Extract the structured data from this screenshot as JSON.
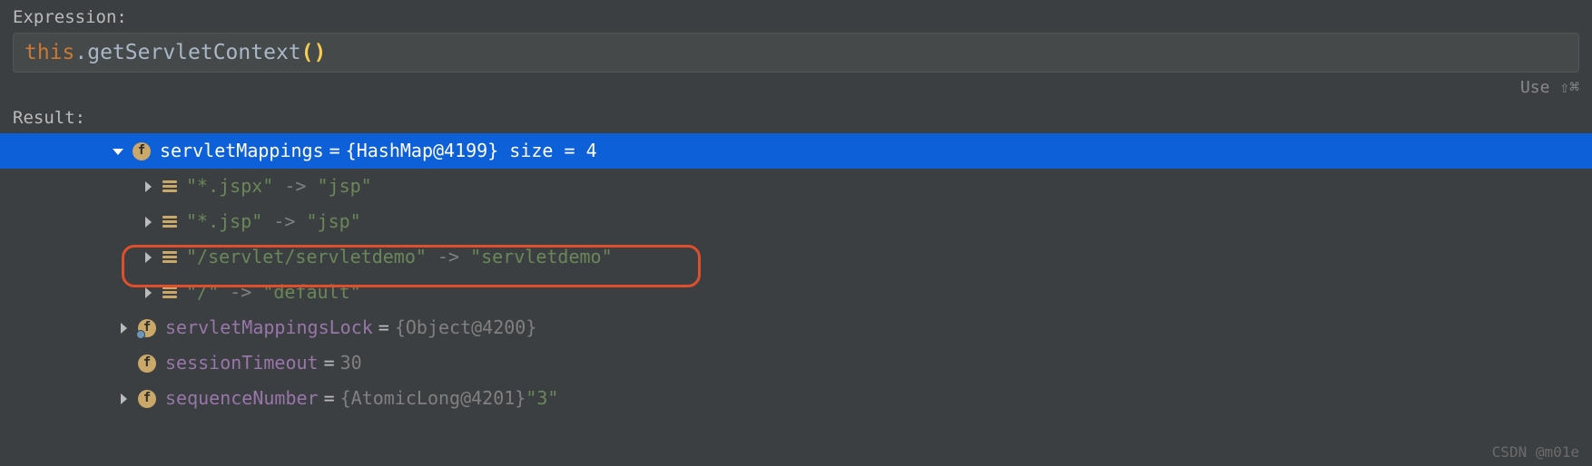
{
  "expression_label": "Expression:",
  "expression": {
    "keyword": "this",
    "dot_method": ".getServletContext",
    "parens": "()"
  },
  "hint": "Use ⇧⌘",
  "result_label": "Result:",
  "tree": {
    "selected": {
      "name": "servletMappings",
      "value": "{HashMap@4199}  size = 4"
    },
    "mappings": [
      {
        "key": "\"*.jspx\"",
        "arrow": "->",
        "val": "\"jsp\""
      },
      {
        "key": "\"*.jsp\"",
        "arrow": "->",
        "val": "\"jsp\""
      },
      {
        "key": "\"/servlet/servletdemo\"",
        "arrow": "->",
        "val": "\"servletdemo\""
      },
      {
        "key": "\"/\"",
        "arrow": "->",
        "val": "\"default\""
      }
    ],
    "siblings": [
      {
        "name": "servletMappingsLock",
        "value": "{Object@4200}",
        "expandable": true,
        "overlay": true
      },
      {
        "name": "sessionTimeout",
        "value": "30",
        "expandable": false,
        "overlay": false
      },
      {
        "name": "sequenceNumber",
        "value": "{AtomicLong@4201} ",
        "strval": "\"3\"",
        "expandable": true,
        "overlay": false
      }
    ]
  },
  "watermark": "CSDN @m01e"
}
